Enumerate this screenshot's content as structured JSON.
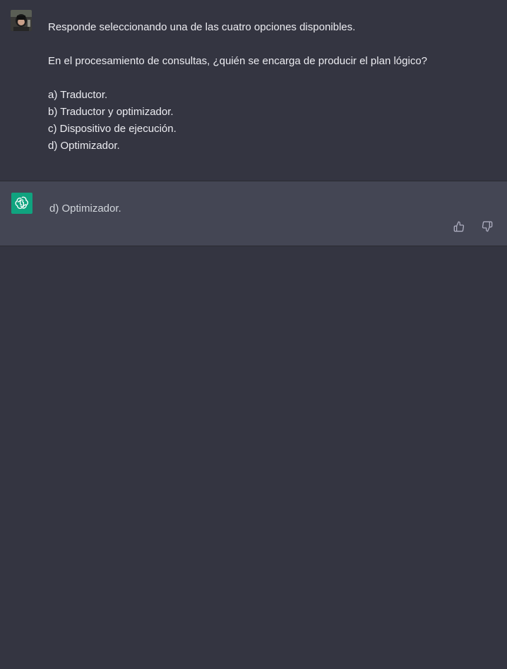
{
  "user_message": {
    "line_1": "Responde seleccionando una de las cuatro opciones disponibles.",
    "question": "En el procesamiento de consultas, ¿quién se encarga de producir el plan lógico?",
    "options": [
      "a) Traductor.",
      "b) Traductor y optimizador.",
      "c) Dispositivo de ejecución.",
      "d) Optimizador."
    ]
  },
  "assistant_message": {
    "text": "d) Optimizador."
  },
  "icons": {
    "user_avatar": "user-avatar-photo",
    "assistant_avatar": "openai-logo-icon",
    "like": "thumbs-up-icon",
    "dislike": "thumbs-down-icon"
  },
  "colors": {
    "background": "#343541",
    "assistant_background": "#444654",
    "assistant_avatar": "#10a37f",
    "text": "#ececf1"
  }
}
